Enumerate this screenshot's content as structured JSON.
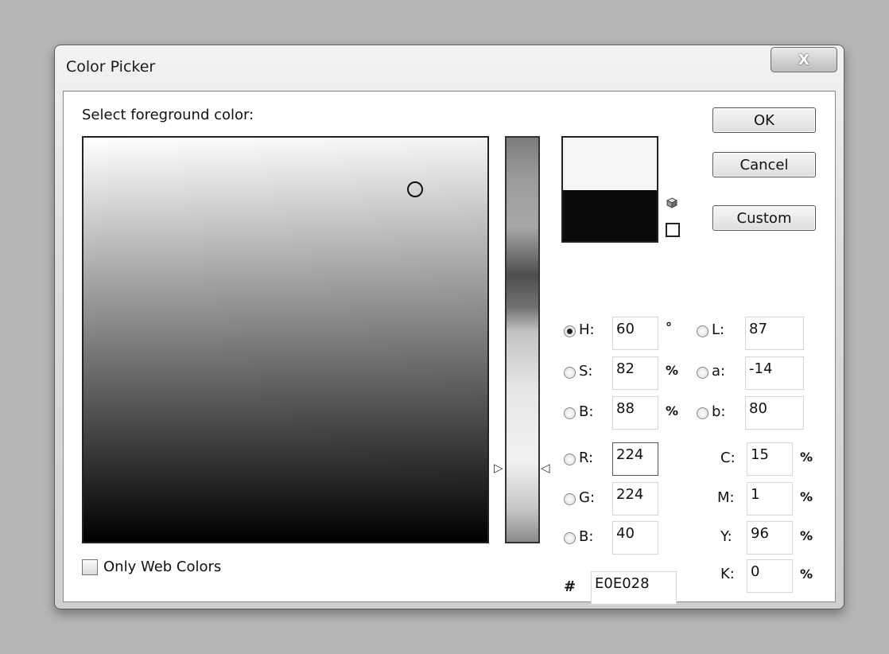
{
  "window": {
    "title": "Color Picker",
    "close_label": "X"
  },
  "dialog": {
    "prompt": "Select foreground color:",
    "buttons": {
      "ok": "OK",
      "cancel": "Cancel",
      "custom": "Custom"
    },
    "only_web_colors": {
      "label": "Only Web Colors",
      "checked": false
    },
    "colors": {
      "new_swatch": "#f5f5f5",
      "current_swatch": "#0a0a0a"
    }
  },
  "fields": {
    "h": {
      "label": "H:",
      "value": "60",
      "unit": "°",
      "selected": true
    },
    "s": {
      "label": "S:",
      "value": "82",
      "unit": "%"
    },
    "bri": {
      "label": "B:",
      "value": "88",
      "unit": "%"
    },
    "l": {
      "label": "L:",
      "value": "87"
    },
    "a": {
      "label": "a:",
      "value": "-14"
    },
    "lab_b": {
      "label": "b:",
      "value": "80"
    },
    "r": {
      "label": "R:",
      "value": "224"
    },
    "g": {
      "label": "G:",
      "value": "224"
    },
    "blue": {
      "label": "B:",
      "value": "40"
    },
    "c": {
      "label": "C:",
      "value": "15",
      "unit": "%"
    },
    "m": {
      "label": "M:",
      "value": "1",
      "unit": "%"
    },
    "y": {
      "label": "Y:",
      "value": "96",
      "unit": "%"
    },
    "k": {
      "label": "K:",
      "value": "0",
      "unit": "%"
    },
    "hex": {
      "label": "#",
      "value": "E0E028"
    }
  }
}
